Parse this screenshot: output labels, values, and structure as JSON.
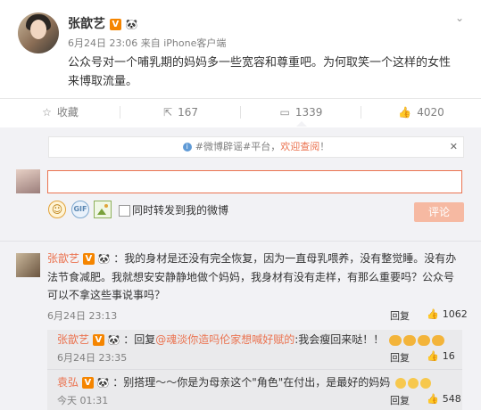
{
  "post": {
    "author": "张歆艺",
    "meta": "6月24日 23:06 来自",
    "device": "iPhone客户端",
    "text": "公众号对一个哺乳期的妈妈多一些宽容和尊重吧。为何取笑一个这样的女性来博取流量。"
  },
  "actions": {
    "favorite": "收藏",
    "share": "167",
    "comment": "1339",
    "like": "4020"
  },
  "notice": {
    "prefix": "#微博辟谣#平台，",
    "link": "欢迎查阅",
    "suffix": "！"
  },
  "reply": {
    "placeholder": "",
    "also_post_label": "同时转发到我的微博",
    "submit": "评论"
  },
  "comments": [
    {
      "name": "张歆艺",
      "text": "：我的身材是还没有完全恢复，因为一直母乳喂养，没有整觉睡。没有办法节食减肥。我就想安安静静地做个妈妈，我身材有没有走样，有那么重要吗？公众号可以不拿这些事说事吗？",
      "time": "6月24日 23:13",
      "reply_label": "回复",
      "likes": "1062",
      "replies": [
        {
          "name": "张歆艺",
          "prefix": "：回复",
          "mention": "@魂淡你造吗伦家想喊好赋的",
          "text": ":我会瘦回来哒！！",
          "time": "6月24日 23:35",
          "reply_label": "回复",
          "likes": "16"
        },
        {
          "name": "袁弘",
          "text": "：别搭理～～你是为母亲这个\"角色\"在付出，是最好的妈妈",
          "time": "今天 01:31",
          "reply_label": "回复",
          "likes": "548"
        }
      ]
    }
  ],
  "colors": {
    "accent": "#eb7350",
    "background": "#f2f2f5",
    "verified": "#f58500"
  },
  "icons": [
    "chevron-down-icon",
    "star-icon",
    "share-icon",
    "comment-icon",
    "thumb-up-icon",
    "info-icon",
    "close-icon",
    "emoji-icon",
    "gif-icon",
    "image-icon"
  ]
}
